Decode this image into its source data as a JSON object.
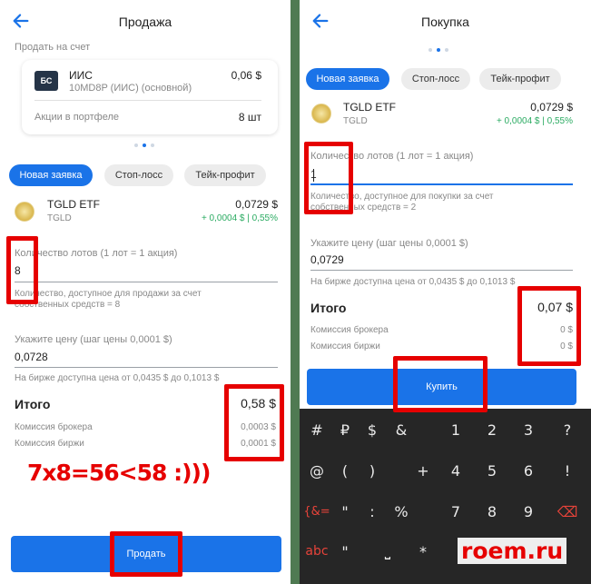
{
  "sell": {
    "title": "Продажа",
    "sell_to_account_label": "Продать на счет",
    "account": {
      "badge": "БС",
      "name": "ИИС",
      "subtitle": "10MD8P (ИИС) (основной)",
      "balance": "0,06 $",
      "shares_label": "Акции в портфеле",
      "shares_value": "8 шт"
    },
    "tabs": [
      "Новая заявка",
      "Стоп-лосс",
      "Тейк-профит"
    ],
    "instrument": {
      "name": "TGLD ETF",
      "ticker": "TGLD",
      "price": "0,0729 $",
      "change": "+ 0,0004 $",
      "change_pct": "0,55%"
    },
    "lots_label": "Количество лотов (1 лот = 1 акция)",
    "lots_value": "8",
    "available_text_1": "Количество, доступное для продажи за счет",
    "available_text_2": "собственных средств = 8",
    "price_label": "Укажите цену (шаг цены 0,0001 $)",
    "price_value": "0,0728",
    "exchange_range": "На бирже доступна цена от 0,0435 $ до 0,1013 $",
    "total_label": "Итого",
    "total_value": "0,58 $",
    "broker_fee_label": "Комиссия брокера",
    "broker_fee_value": "0,0003 $",
    "exchange_fee_label": "Комиссия биржи",
    "exchange_fee_value": "0,0001 $",
    "annotation": "7x8=56<58   :)))",
    "button": "Продать"
  },
  "buy": {
    "title": "Покупка",
    "tabs": [
      "Новая заявка",
      "Стоп-лосс",
      "Тейк-профит"
    ],
    "instrument": {
      "name": "TGLD ETF",
      "ticker": "TGLD",
      "price": "0,0729 $",
      "change": "+ 0,0004 $",
      "change_pct": "0,55%"
    },
    "lots_label": "Количество лотов (1 лот = 1 акция)",
    "lots_value": "1",
    "available_text_1": "Количество, доступное для покупки за счет",
    "available_text_2": "собственных средств = 2",
    "price_label": "Укажите цену (шаг цены 0,0001 $)",
    "price_value": "0,0729",
    "exchange_range": "На бирже доступна цена от 0,0435 $ до 0,1013 $",
    "total_label": "Итого",
    "total_value": "0,07 $",
    "broker_fee_label": "Комиссия брокера",
    "broker_fee_value": "0 $",
    "exchange_fee_label": "Комиссия биржи",
    "exchange_fee_value": "0 $",
    "button": "Купить"
  },
  "keyboard": {
    "row1": [
      "#",
      "₽",
      "$",
      "&",
      "1",
      "2",
      "3",
      "?"
    ],
    "row2": [
      "@",
      "(",
      ")",
      "+",
      "4",
      "5",
      "6",
      "!"
    ],
    "row3": [
      "{&=",
      "\"",
      ":",
      "%",
      "7",
      "8",
      "9",
      "⌫"
    ],
    "row4": [
      "abc",
      "\"",
      "⎵",
      "*",
      "",
      "",
      "",
      ""
    ]
  },
  "watermark": "roem.ru",
  "colors": {
    "accent": "#1a73e8",
    "positive": "#2bab62",
    "highlight": "#e60000"
  }
}
